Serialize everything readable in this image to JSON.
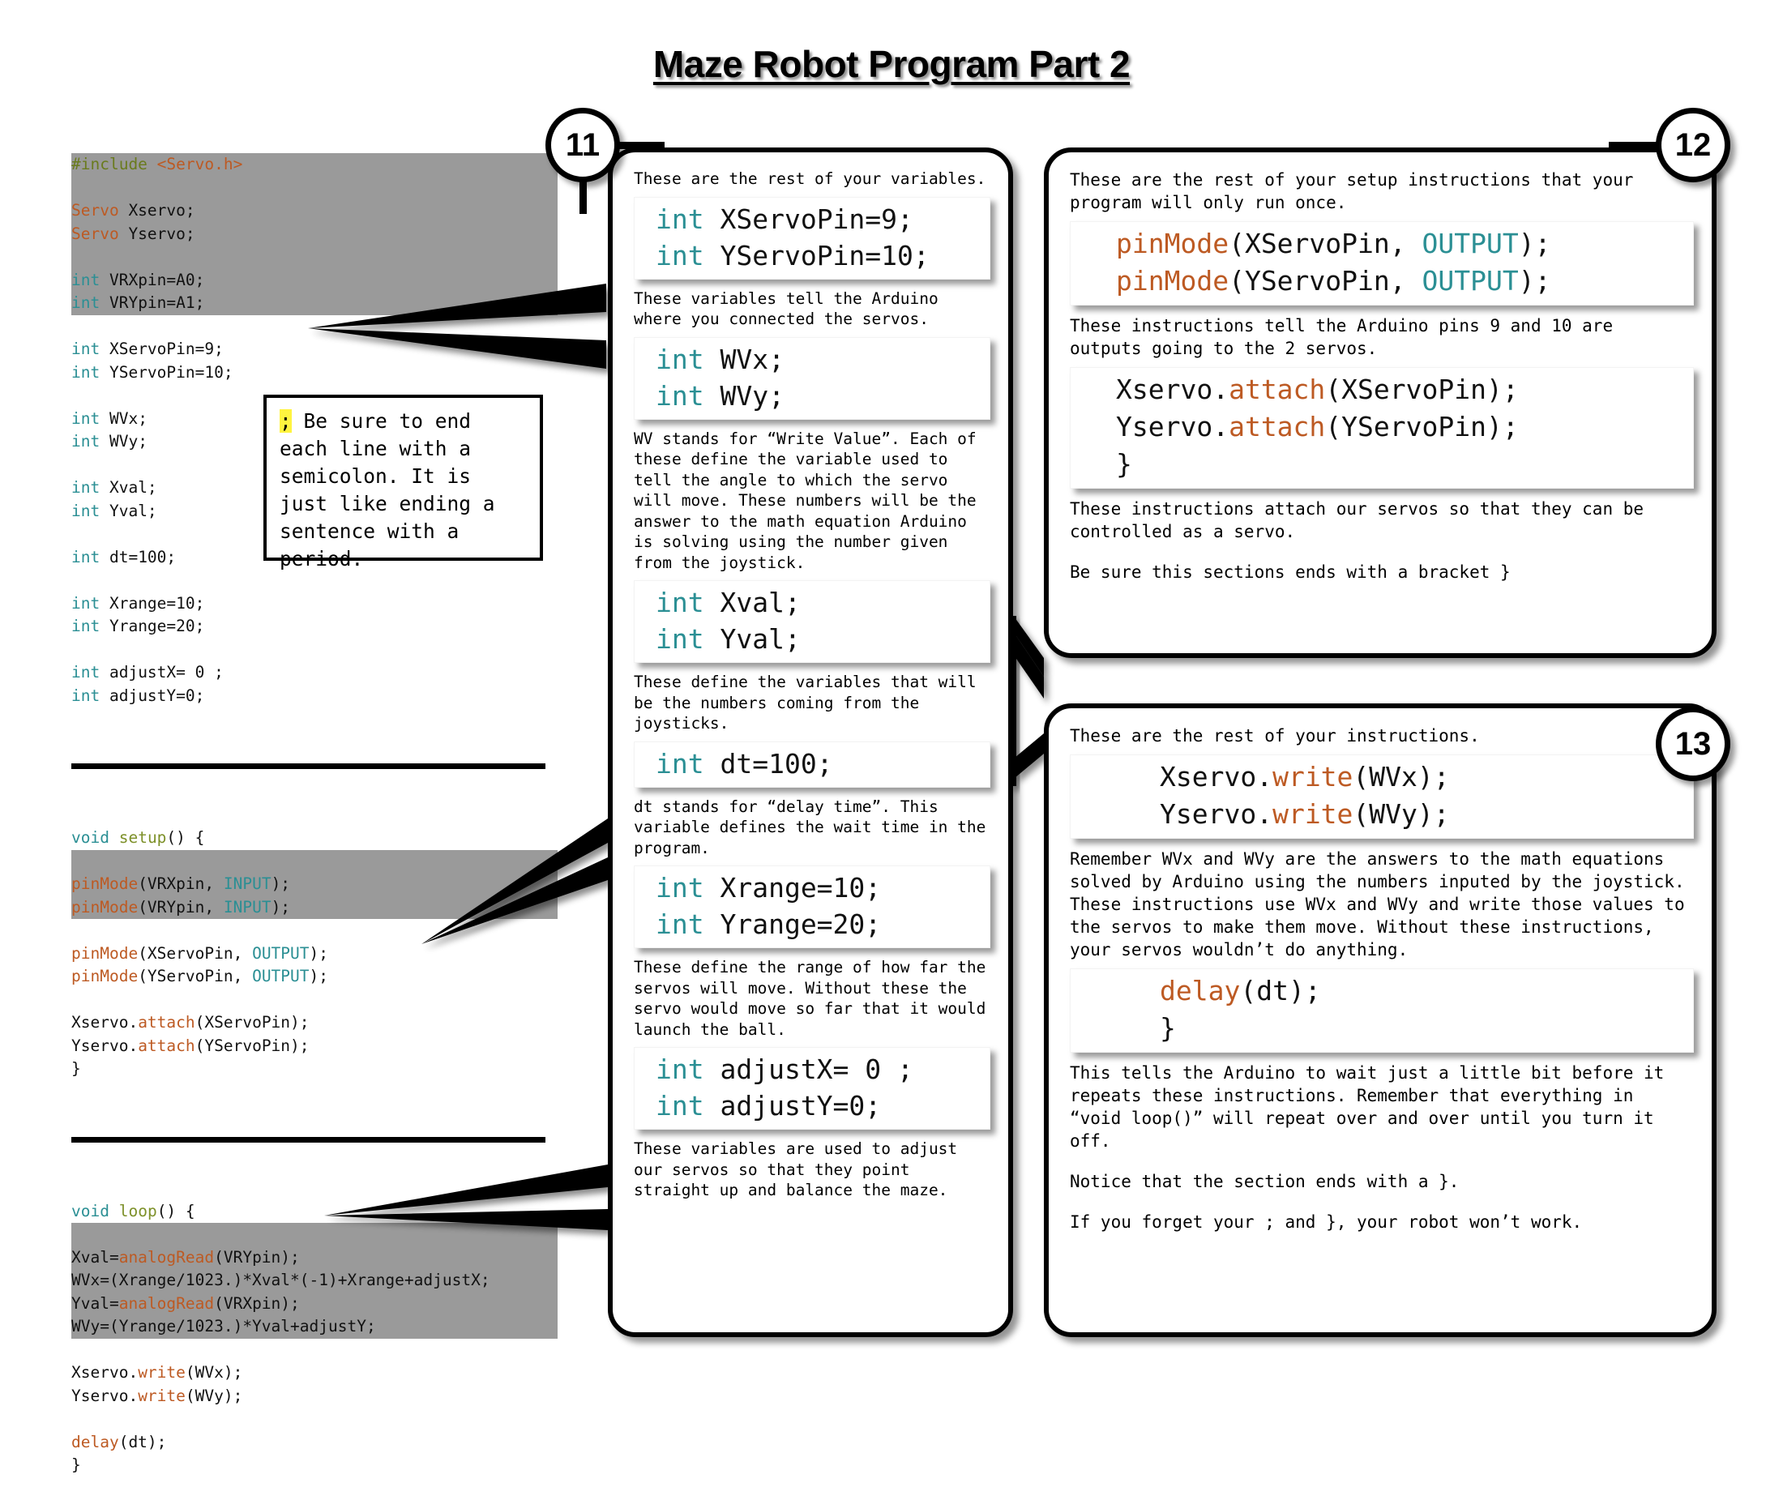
{
  "title": "Maze Robot Program Part 2",
  "colors": {
    "type_keyword": "#2b8f94",
    "function_name": "#7d9029",
    "library_call": "#bd5a23",
    "preprocessor": "#6a7b1e",
    "code_highlight_band": "#9a9a9a",
    "semicolon_highlight": "#fff43f"
  },
  "code_panel": {
    "lines": [
      {
        "text": "#include <Servo.h>",
        "band": true
      },
      {
        "text": "",
        "band": true
      },
      {
        "text": "Servo Xservo;",
        "band": true
      },
      {
        "text": "Servo Yservo;",
        "band": true
      },
      {
        "text": "",
        "band": true
      },
      {
        "text": "int VRXpin=A0;",
        "band": true
      },
      {
        "text": "int VRYpin=A1;",
        "band": true
      },
      {
        "text": "",
        "band": false
      },
      {
        "text": "int XServoPin=9;",
        "band": false
      },
      {
        "text": "int YServoPin=10;",
        "band": false
      },
      {
        "text": "",
        "band": false
      },
      {
        "text": "int WVx;",
        "band": false
      },
      {
        "text": "int WVy;",
        "band": false
      },
      {
        "text": "",
        "band": false
      },
      {
        "text": "int Xval;",
        "band": false
      },
      {
        "text": "int Yval;",
        "band": false
      },
      {
        "text": "",
        "band": false
      },
      {
        "text": "int dt=100;",
        "band": false
      },
      {
        "text": "",
        "band": false
      },
      {
        "text": "int Xrange=10;",
        "band": false
      },
      {
        "text": "int Yrange=20;",
        "band": false
      },
      {
        "text": "",
        "band": false
      },
      {
        "text": "int adjustX= 0 ;",
        "band": false
      },
      {
        "text": "int adjustY=0;",
        "band": false
      }
    ],
    "setup_lines": [
      {
        "text": "void setup() {",
        "band": false
      },
      {
        "text": "",
        "band": true
      },
      {
        "text": "pinMode(VRXpin, INPUT);",
        "band": true
      },
      {
        "text": "pinMode(VRYpin, INPUT);",
        "band": true
      },
      {
        "text": "",
        "band": false
      },
      {
        "text": "pinMode(XServoPin, OUTPUT);",
        "band": false
      },
      {
        "text": "pinMode(YServoPin, OUTPUT);",
        "band": false
      },
      {
        "text": "",
        "band": false
      },
      {
        "text": "Xservo.attach(XServoPin);",
        "band": false
      },
      {
        "text": "Yservo.attach(YServoPin);",
        "band": false
      },
      {
        "text": "}",
        "band": false
      }
    ],
    "loop_lines": [
      {
        "text": "void loop() {",
        "band": false
      },
      {
        "text": "",
        "band": true
      },
      {
        "text": "Xval=analogRead(VRYpin);",
        "band": true
      },
      {
        "text": "WVx=(Xrange/1023.)*Xval*(-1)+Xrange+adjustX;",
        "band": true
      },
      {
        "text": "Yval=analogRead(VRXpin);",
        "band": true
      },
      {
        "text": "WVy=(Yrange/1023.)*Yval+adjustY;",
        "band": true
      },
      {
        "text": "",
        "band": false
      },
      {
        "text": "Xservo.write(WVx);",
        "band": false
      },
      {
        "text": "Yservo.write(WVy);",
        "band": false
      },
      {
        "text": "",
        "band": false
      },
      {
        "text": "delay(dt);",
        "band": false
      },
      {
        "text": "}",
        "band": false
      }
    ]
  },
  "note_box": {
    "semicolon": ";",
    "text": " Be sure to end each line with a semicolon. It is just like ending a sentence with a period."
  },
  "steps": {
    "eleven": "11",
    "twelve": "12",
    "thirteen": "13"
  },
  "bubble_11": {
    "p1": "These are the rest of your variables.",
    "snippet1_l1": "int XServoPin=9;",
    "snippet1_l2": "int YServoPin=10;",
    "p2": "These variables tell the Arduino where you connected the servos.",
    "snippet2_l1": "int WVx;",
    "snippet2_l2": "int WVy;",
    "p3": "WV stands for “Write Value”. Each of these define the variable used to tell the angle to which the servo will move. These numbers will be the answer to the math equation Arduino is solving using the number given from the joystick.",
    "snippet3_l1": "int Xval;",
    "snippet3_l2": "int Yval;",
    "p4": "These define the variables that will be the numbers coming from the joysticks.",
    "snippet4_l1": "int dt=100;",
    "p5": "dt stands for “delay time”. This variable defines the wait time in the program.",
    "snippet5_l1": "int Xrange=10;",
    "snippet5_l2": "int Yrange=20;",
    "p6": "These define the range of how far the servos will move. Without these the servo would move so far that it would launch the ball.",
    "snippet6_l1": "int adjustX= 0 ;",
    "snippet6_l2": "int adjustY=0;",
    "p7": "These variables are used to adjust our servos so that they point straight up and balance the maze."
  },
  "bubble_12": {
    "p1": "These are the rest of your setup instructions that your program will only run once.",
    "snippet1_l1": "pinMode(XServoPin, OUTPUT);",
    "snippet1_l2": "pinMode(YServoPin, OUTPUT);",
    "p2": "These instructions tell the Arduino pins 9 and 10 are outputs going to the 2 servos.",
    "snippet2_l1": "Xservo.attach(XServoPin);",
    "snippet2_l2": "Yservo.attach(YServoPin);",
    "snippet2_l3": "}",
    "p3": "These instructions attach our servos so that they can be controlled as a servo.",
    "p4": "Be sure this sections ends with a bracket }"
  },
  "bubble_13": {
    "p1": "These are the rest of your instructions.",
    "snippet1_l1": "Xservo.write(WVx);",
    "snippet1_l2": "Yservo.write(WVy);",
    "p2": "Remember WVx and WVy are the answers to the math equations solved by Arduino using the numbers inputed by the joystick. These instructions use WVx and WVy and write those values to the servos to make them move. Without these instructions, your servos wouldn’t do anything.",
    "snippet2_l1": "delay(dt);",
    "snippet2_l2": "}",
    "p3": "This tells the Arduino to wait just a little bit before it repeats these instructions. Remember that everything in “void loop()” will repeat over and over until you turn it off.",
    "p4": "Notice that the section ends with a }.",
    "p5": "If you forget your ; and }, your robot won’t work."
  }
}
